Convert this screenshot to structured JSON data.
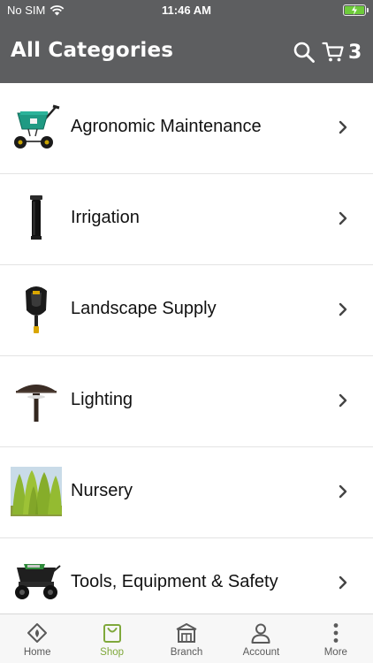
{
  "status_bar": {
    "carrier": "No SIM",
    "time": "11:46 AM",
    "battery_color": "#6ecb3b"
  },
  "header": {
    "title": "All Categories",
    "cart_count": "3",
    "background": "#5d5e60"
  },
  "categories": [
    {
      "label": "Agronomic Maintenance",
      "icon": "spreader-icon"
    },
    {
      "label": "Irrigation",
      "icon": "sprinkler-head-icon"
    },
    {
      "label": "Landscape Supply",
      "icon": "shovel-icon"
    },
    {
      "label": "Lighting",
      "icon": "path-light-icon"
    },
    {
      "label": "Nursery",
      "icon": "shrubs-photo"
    },
    {
      "label": "Tools, Equipment & Safety",
      "icon": "wheelbarrow-icon"
    }
  ],
  "tabs": [
    {
      "label": "Home",
      "icon": "home-icon",
      "active": false
    },
    {
      "label": "Shop",
      "icon": "shopping-bag-icon",
      "active": true
    },
    {
      "label": "Branch",
      "icon": "storefront-icon",
      "active": false
    },
    {
      "label": "Account",
      "icon": "person-icon",
      "active": false
    },
    {
      "label": "More",
      "icon": "more-vertical-icon",
      "active": false
    }
  ],
  "accent_color": "#7fa83b"
}
